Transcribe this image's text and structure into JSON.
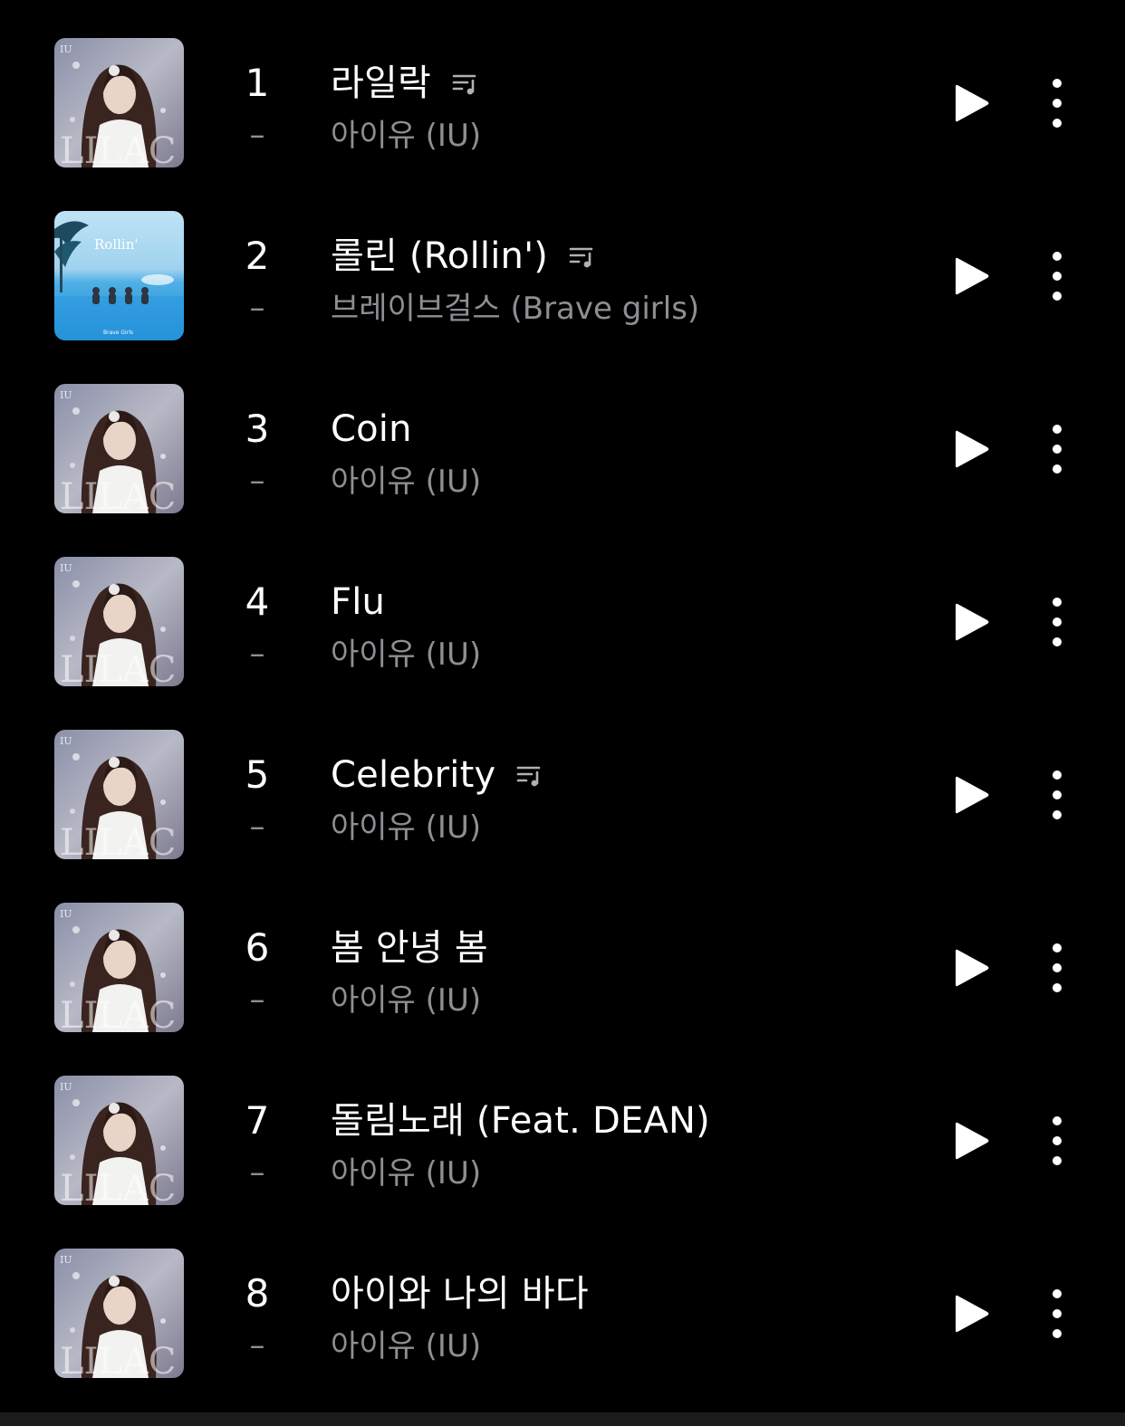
{
  "colors": {
    "background": "#000000",
    "primary_text": "#ffffff",
    "secondary_text": "#8e8e93",
    "icon": "#ffffff"
  },
  "icons": {
    "play": "play-icon",
    "more": "more-vertical-icon",
    "lyrics": "lyrics-icon"
  },
  "songs": [
    {
      "rank": "1",
      "change": "–",
      "title": "라일락",
      "artist": "아이유 (IU)",
      "has_lyrics": true,
      "album": "lilac"
    },
    {
      "rank": "2",
      "change": "–",
      "title": "롤린 (Rollin')",
      "artist": "브레이브걸스 (Brave girls)",
      "has_lyrics": true,
      "album": "rollin"
    },
    {
      "rank": "3",
      "change": "–",
      "title": "Coin",
      "artist": "아이유 (IU)",
      "has_lyrics": false,
      "album": "lilac"
    },
    {
      "rank": "4",
      "change": "–",
      "title": "Flu",
      "artist": "아이유 (IU)",
      "has_lyrics": false,
      "album": "lilac"
    },
    {
      "rank": "5",
      "change": "–",
      "title": "Celebrity",
      "artist": "아이유 (IU)",
      "has_lyrics": true,
      "album": "lilac"
    },
    {
      "rank": "6",
      "change": "–",
      "title": "봄 안녕 봄",
      "artist": "아이유 (IU)",
      "has_lyrics": false,
      "album": "lilac"
    },
    {
      "rank": "7",
      "change": "–",
      "title": "돌림노래 (Feat. DEAN)",
      "artist": "아이유 (IU)",
      "has_lyrics": false,
      "album": "lilac"
    },
    {
      "rank": "8",
      "change": "–",
      "title": "아이와 나의 바다",
      "artist": "아이유 (IU)",
      "has_lyrics": false,
      "album": "lilac"
    }
  ],
  "album_art": {
    "lilac": {
      "label_large": "LILAC",
      "label_small": "IU"
    },
    "rollin": {
      "label_large": "Rollin'",
      "label_small": "Brave Girls"
    }
  }
}
